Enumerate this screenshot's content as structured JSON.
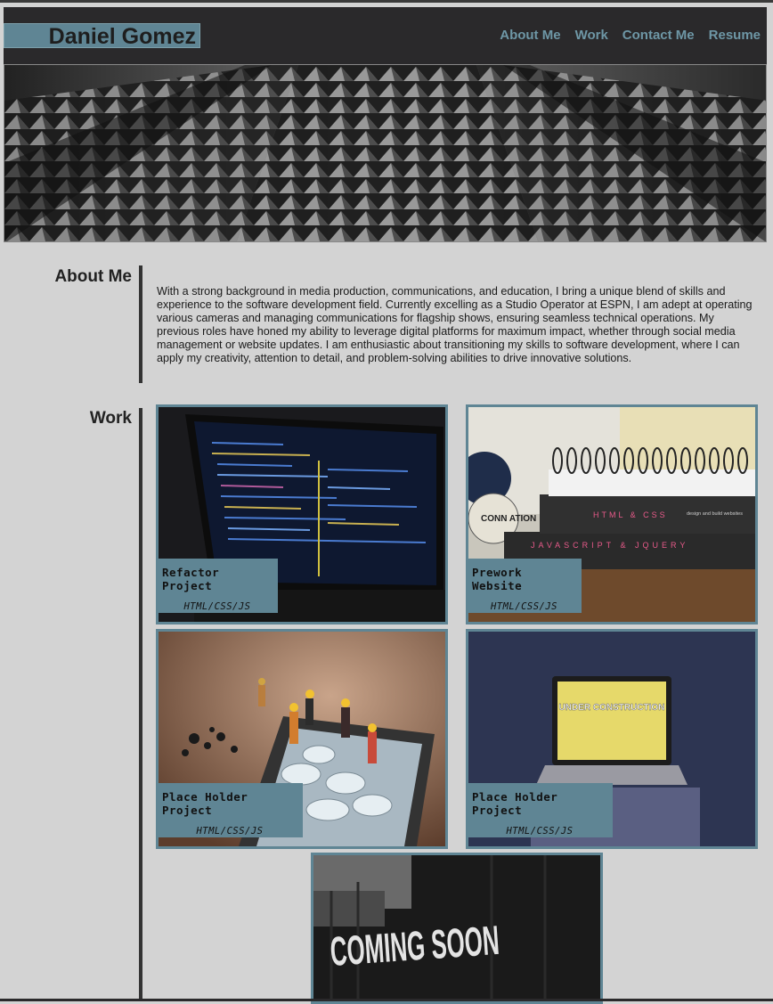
{
  "header": {
    "name": "Daniel Gomez",
    "nav": [
      "About Me",
      "Work",
      "Contact Me",
      "Resume"
    ]
  },
  "about": {
    "title": "About Me",
    "text": "With a strong background in media production, communications, and education, I bring a unique blend of skills and experience to the software development field. Currently excelling as a Studio Operator at ESPN, I am adept at operating various cameras and managing communications for flagship shows, ensuring seamless technical operations. My previous roles have honed my ability to leverage digital platforms for maximum impact, whether through social media management or website updates. I am enthusiastic about transitioning my skills to software development, where I can apply my creativity, attention to detail, and problem-solving abilities to drive innovative solutions."
  },
  "work": {
    "title": "Work",
    "projects": [
      {
        "title": "Refactor Project",
        "tech": "HTML/CSS/JS"
      },
      {
        "title": "Prework Website",
        "tech": "HTML/CSS/JS"
      },
      {
        "title": "Place Holder Project",
        "tech": "HTML/CSS/JS"
      },
      {
        "title": "Place Holder Project",
        "tech": "HTML/CSS/JS"
      }
    ],
    "coming_soon": "COMING SOON",
    "book_spine_1": "HTML & CSS",
    "book_spine_1_sub": "design and build websites",
    "book_spine_2": "JAVASCRIPT & JQUERY",
    "laptop_screen": "UNDER CONSTRUCTION",
    "sticker": "CONN ATION"
  },
  "colors": {
    "accent": "#5f8594",
    "nav": "#6e97a6",
    "header_bg": "#2a292b",
    "page_bg": "#d3d3d3"
  }
}
